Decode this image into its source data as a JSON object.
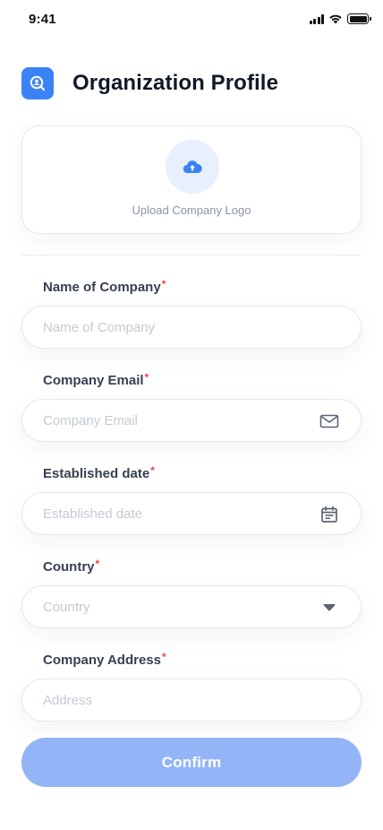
{
  "status_bar": {
    "time": "9:41"
  },
  "header": {
    "title": "Organization Profile",
    "icon": "search-badge-icon"
  },
  "upload": {
    "label": "Upload Company Logo",
    "icon": "cloud-upload-icon"
  },
  "form": {
    "required_marker": "*",
    "fields": [
      {
        "label": "Name of Company",
        "placeholder": "Name of Company",
        "value": ""
      },
      {
        "label": "Company Email",
        "placeholder": "Company Email",
        "value": "",
        "icon": "mail-icon"
      },
      {
        "label": "Established date",
        "placeholder": "Established date",
        "value": "",
        "icon": "calendar-icon"
      },
      {
        "label": "Country",
        "placeholder": "Country",
        "value": "",
        "icon": "dropdown-caret-icon"
      },
      {
        "label": "Company Address",
        "placeholder": "Address",
        "value": ""
      }
    ]
  },
  "confirm": {
    "label": "Confirm"
  },
  "colors": {
    "accent": "#3b82f6",
    "button_disabled": "#93b5f8",
    "required": "#ef4444",
    "placeholder": "#c4cad4"
  }
}
